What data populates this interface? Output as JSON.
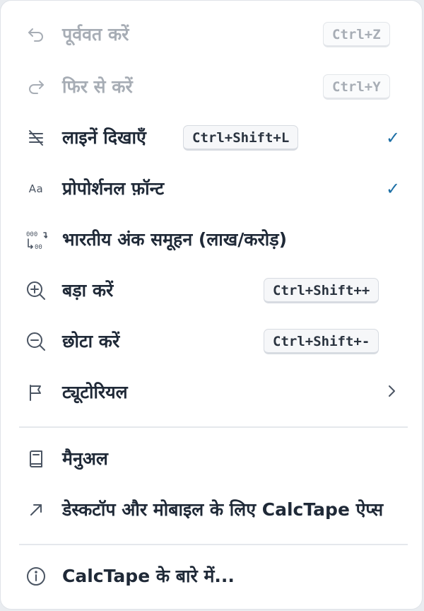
{
  "menu": {
    "items": [
      {
        "label": "पूर्ववत करें",
        "shortcut": "Ctrl+Z",
        "icon": "undo-icon",
        "disabled": true
      },
      {
        "label": "फिर से करें",
        "shortcut": "Ctrl+Y",
        "icon": "redo-icon",
        "disabled": true
      },
      {
        "label": "लाइनें दिखाएँ",
        "shortcut": "Ctrl+Shift+L",
        "icon": "lines-off-icon",
        "checked": "✓"
      },
      {
        "label": "प्रोपोर्शनल फ़ॉन्ट",
        "icon_text": "Aa",
        "icon": "font-icon",
        "checked": "✓"
      },
      {
        "label": "भारतीय अंक समूहन (लाख/करोड़)",
        "icon": "digit-grouping-icon"
      },
      {
        "label": "बड़ा करें",
        "shortcut": "Ctrl+Shift++",
        "icon": "zoom-in-icon"
      },
      {
        "label": "छोटा करें",
        "shortcut": "Ctrl+Shift+-",
        "icon": "zoom-out-icon"
      },
      {
        "label": "ट्यूटोरियल",
        "icon": "flag-icon",
        "submenu": true
      }
    ],
    "items2": [
      {
        "label": "मैनुअल",
        "icon": "book-icon"
      },
      {
        "label": "डेस्कटॉप और मोबाइल के लिए CalcTape ऐप्स",
        "icon": "external-arrow-icon"
      }
    ],
    "items3": [
      {
        "label": "CalcTape के बारे में...",
        "icon": "info-icon"
      }
    ]
  },
  "colors": {
    "text": "#1f2937",
    "disabled": "#a7adb5",
    "check": "#1d6fa5"
  }
}
